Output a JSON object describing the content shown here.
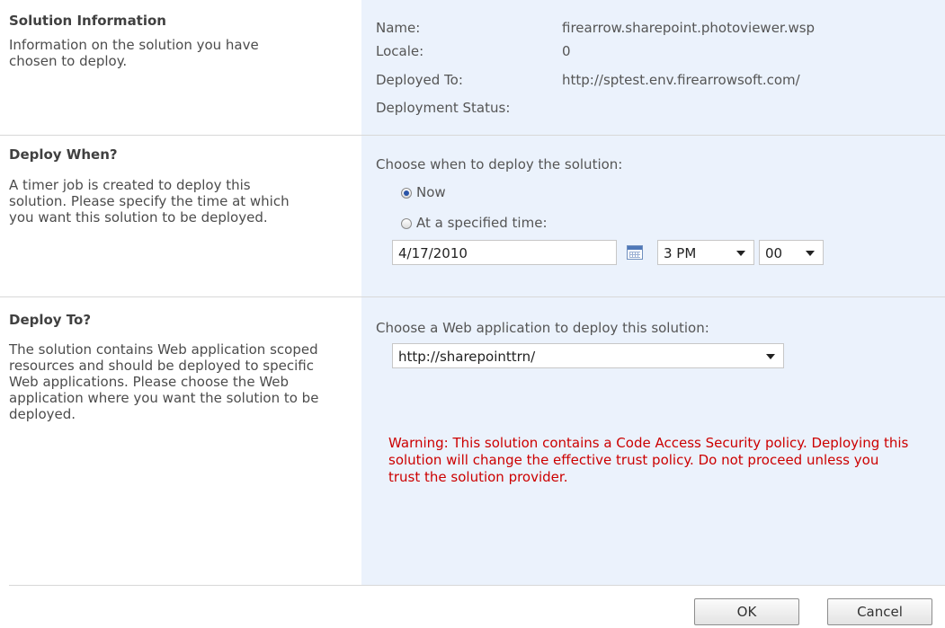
{
  "solution_info": {
    "title": "Solution Information",
    "description": "Information on the solution you have chosen to deploy.",
    "name_label": "Name:",
    "name_value": "firearrow.sharepoint.photoviewer.wsp",
    "locale_label": "Locale:",
    "locale_value": "0",
    "deployed_to_label": "Deployed To:",
    "deployed_to_value": "http://sptest.env.firearrowsoft.com/",
    "status_label": "Deployment Status:"
  },
  "deploy_when": {
    "title": "Deploy When?",
    "description": "A timer job is created to deploy this solution. Please specify the time at which you want this solution to be deployed.",
    "prompt": "Choose when to deploy the solution:",
    "option_now": "Now",
    "option_specified": "At a specified time:",
    "selected": "Now",
    "date_value": "4/17/2010",
    "hour_value": "3 PM",
    "minute_value": "00"
  },
  "deploy_to": {
    "title": "Deploy To?",
    "description": "The solution contains Web application scoped resources and should be deployed to specific Web applications. Please choose the Web application where you want the solution to be deployed.",
    "prompt": "Choose a Web application to deploy this solution:",
    "web_app_value": "http://sharepointtrn/",
    "warning": "Warning: This solution contains a Code Access Security policy. Deploying this solution will change the effective trust policy. Do not proceed unless you trust the solution provider."
  },
  "buttons": {
    "ok": "OK",
    "cancel": "Cancel"
  },
  "colors": {
    "panel_background": "#ebf2fc",
    "warning": "#cc0000",
    "radio_selected": "#2a55a8"
  },
  "icons": {
    "calendar": "calendar-icon",
    "dropdown": "chevron-down-icon"
  }
}
